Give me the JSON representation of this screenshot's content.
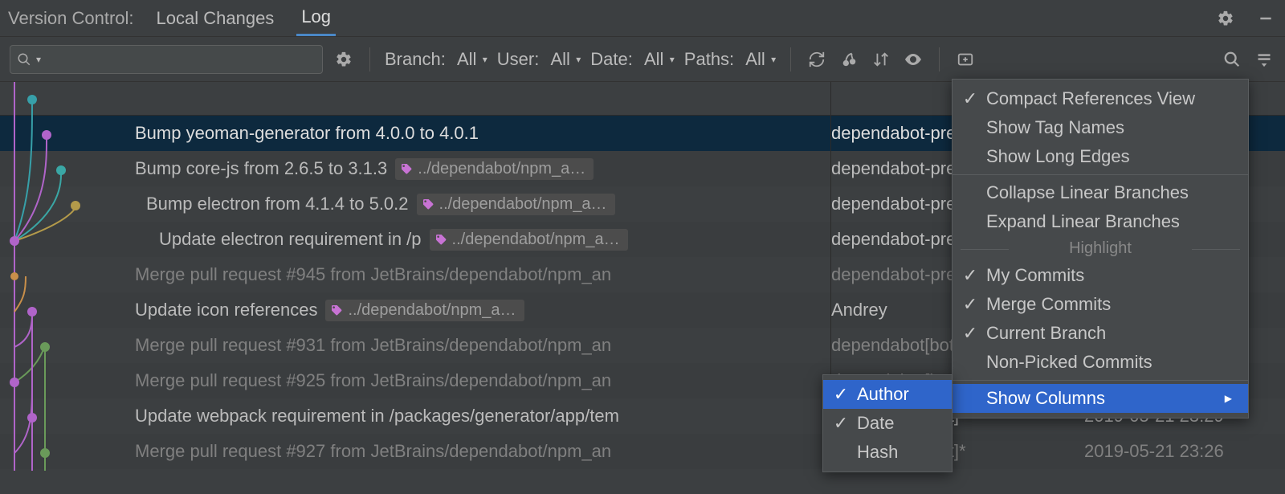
{
  "topbar": {
    "title": "Version Control:",
    "tabs": [
      "Local Changes",
      "Log"
    ],
    "active_tab": 1
  },
  "toolbar": {
    "search_placeholder": "",
    "filters": {
      "branch_label": "Branch:",
      "branch_value": "All",
      "user_label": "User:",
      "user_value": "All",
      "date_label": "Date:",
      "date_value": "All",
      "paths_label": "Paths:",
      "paths_value": "All"
    }
  },
  "commits": [
    {
      "indent": 168,
      "message": "Bump yeoman-generator from 4.0.0 to 4.0.1",
      "tag": "",
      "author": "dependabot-preview[bot]*",
      "date": "",
      "merge": false,
      "selected": true
    },
    {
      "indent": 168,
      "message": "Bump core-js from 2.6.5 to 3.1.3",
      "tag": "../dependabot/npm_a…",
      "author": "dependabot-preview[bot]*",
      "date": "",
      "merge": false
    },
    {
      "indent": 182,
      "message": "Bump electron from 4.1.4 to 5.0.2",
      "tag": "../dependabot/npm_a…",
      "author": "dependabot-preview[bot]*",
      "date": "",
      "merge": false
    },
    {
      "indent": 198,
      "message": "Update electron requirement in /p",
      "tag": "../dependabot/npm_a…",
      "author": "dependabot-preview[bot]*",
      "date": "",
      "merge": false
    },
    {
      "indent": 168,
      "message": "Merge pull request #945 from JetBrains/dependabot/npm_an",
      "tag": "",
      "author": "dependabot-preview[bot]*",
      "date": "",
      "merge": true
    },
    {
      "indent": 168,
      "message": "Update icon references",
      "tag": "../dependabot/npm_a…",
      "author": "Andrey",
      "date": "",
      "merge": false
    },
    {
      "indent": 168,
      "message": "Merge pull request #931 from JetBrains/dependabot/npm_an",
      "tag": "",
      "author": "dependabot[bot]*",
      "date": "",
      "merge": true
    },
    {
      "indent": 168,
      "message": "Merge pull request #925 from JetBrains/dependabot/npm_an",
      "tag": "",
      "author": "dependabot[bot]*",
      "date": "",
      "merge": true
    },
    {
      "indent": 168,
      "message": "Update webpack requirement in /packages/generator/app/tem",
      "tag": "",
      "author": "dependabot[bot]*",
      "date": "2019-05-21 23:29",
      "merge": false
    },
    {
      "indent": 168,
      "message": "Merge pull request #927 from JetBrains/dependabot/npm_an",
      "tag": "",
      "author": "dependabot[bot]*",
      "date": "2019-05-21 23:26",
      "merge": true
    }
  ],
  "popup_main": {
    "groups": [
      [
        {
          "label": "Compact References View",
          "checked": true
        },
        {
          "label": "Show Tag Names",
          "checked": false
        },
        {
          "label": "Show Long Edges",
          "checked": false
        }
      ],
      [
        {
          "label": "Collapse Linear Branches",
          "checked": false
        },
        {
          "label": "Expand Linear Branches",
          "checked": false
        }
      ]
    ],
    "highlight_header": "Highlight",
    "highlight": [
      {
        "label": "My Commits",
        "checked": true
      },
      {
        "label": "Merge Commits",
        "checked": true
      },
      {
        "label": "Current Branch",
        "checked": true
      },
      {
        "label": "Non-Picked Commits",
        "checked": false
      }
    ],
    "show_columns_label": "Show Columns"
  },
  "popup_columns": [
    {
      "label": "Author",
      "checked": true,
      "selected": true
    },
    {
      "label": "Date",
      "checked": true
    },
    {
      "label": "Hash",
      "checked": false
    }
  ]
}
